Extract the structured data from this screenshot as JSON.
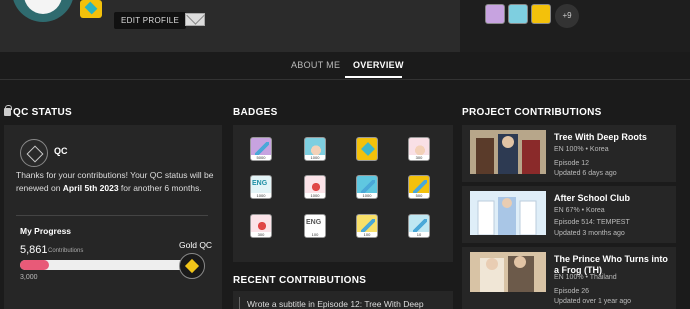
{
  "header": {
    "edit_profile": "EDIT PROFILE",
    "more_badges": "+9"
  },
  "tabs": {
    "about": "ABOUT ME",
    "overview": "OVERVIEW"
  },
  "qc": {
    "title": "QC STATUS",
    "label": "QC",
    "message_pre": "Thanks for your contributions! Your QC status will be renewed on ",
    "message_date": "April 5th 2023",
    "message_post": " for another 6 months.",
    "progress_title": "My Progress",
    "contributions": "5,861",
    "contributions_label": "Contributions",
    "min_value": "3,000",
    "goal_label": "Gold QC",
    "progress_fraction": 0.17
  },
  "badges": {
    "title": "BADGES",
    "items": [
      {
        "icon": "pencil-icon",
        "cap": "5000",
        "color": "#c7a3e0"
      },
      {
        "icon": "queen-icon",
        "cap": "1000",
        "color": "#7ecfe0"
      },
      {
        "icon": "diamond-icon",
        "cap": "",
        "color": "#f3c10b"
      },
      {
        "icon": "queen-icon",
        "cap": "300",
        "color": "#f9e0e6"
      },
      {
        "icon": "eng-icon",
        "cap": "1000",
        "color": "#e3f4f7"
      },
      {
        "icon": "girl-icon",
        "cap": "1000",
        "color": "#fbe3e8"
      },
      {
        "icon": "pencil-icon",
        "cap": "1000",
        "color": "#5fc7e0"
      },
      {
        "icon": "pencil-icon",
        "cap": "500",
        "color": "#f3c10b"
      },
      {
        "icon": "girl-icon",
        "cap": "300",
        "color": "#fbe3e8"
      },
      {
        "icon": "eng-icon",
        "cap": "100",
        "color": "#ffffff"
      },
      {
        "icon": "pencil-icon",
        "cap": "100",
        "color": "#f8e06a"
      },
      {
        "icon": "pencil-icon",
        "cap": "10",
        "color": "#bfe7f2"
      }
    ]
  },
  "recent": {
    "title": "RECENT CONTRIBUTIONS",
    "item": "Wrote a subtitle in Episode 12: Tree With Deep"
  },
  "projects": {
    "title": "PROJECT CONTRIBUTIONS",
    "items": [
      {
        "title": "Tree With Deep Roots",
        "meta": "EN 100% • Korea",
        "episode": "Episode 12",
        "updated": "Updated 6 days ago"
      },
      {
        "title": "After School Club",
        "meta": "EN 67% • Korea",
        "episode": "Episode 514: TEMPEST",
        "updated": "Updated 3 months ago"
      },
      {
        "title": "The Prince Who Turns into a Frog (TH)",
        "meta": "EN 100% • Thailand",
        "episode": "Episode 26",
        "updated": "Updated over 1 year ago"
      }
    ]
  }
}
